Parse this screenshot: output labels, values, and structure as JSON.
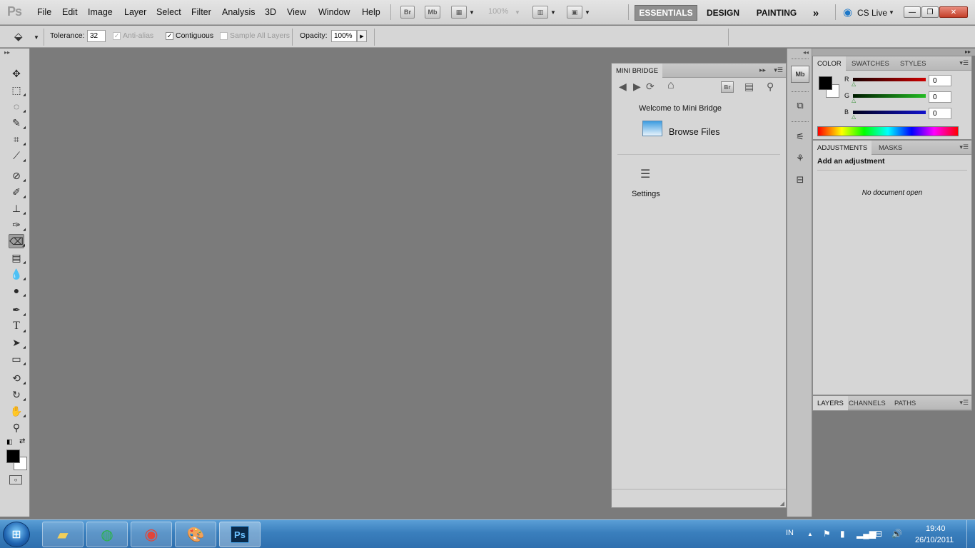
{
  "menubar": {
    "logo": "Ps",
    "items": [
      "File",
      "Edit",
      "Image",
      "Layer",
      "Select",
      "Filter",
      "Analysis",
      "3D",
      "View",
      "Window",
      "Help"
    ],
    "bridge_btn": "Br",
    "minibridge_btn": "Mb",
    "zoom": "100%",
    "workspaces": [
      "ESSENTIALS",
      "DESIGN",
      "PAINTING"
    ],
    "more_workspaces": "»",
    "cslive": "CS Live"
  },
  "options": {
    "tolerance_label": "Tolerance:",
    "tolerance_value": "32",
    "antialias_label": "Anti-alias",
    "contiguous_label": "Contiguous",
    "sample_all_label": "Sample All Layers",
    "opacity_label": "Opacity:",
    "opacity_value": "100%"
  },
  "minibridge": {
    "tab": "MINI BRIDGE",
    "welcome": "Welcome to Mini Bridge",
    "browse": "Browse Files",
    "settings": "Settings",
    "br_btn": "Br"
  },
  "dock": {
    "mb_label": "Mb"
  },
  "color_panel": {
    "tabs": [
      "COLOR",
      "SWATCHES",
      "STYLES"
    ],
    "r_label": "R",
    "g_label": "G",
    "b_label": "B",
    "r_value": "0",
    "g_value": "0",
    "b_value": "0",
    "colors": {
      "r": "#cc0000",
      "g": "#22bb22",
      "b": "#1111cc"
    }
  },
  "adjustments_panel": {
    "tabs": [
      "ADJUSTMENTS",
      "MASKS"
    ],
    "title": "Add an adjustment",
    "status": "No document open"
  },
  "layers_panel": {
    "tabs": [
      "LAYERS",
      "CHANNELS",
      "PATHS"
    ]
  },
  "taskbar": {
    "lang": "IN",
    "time": "19:40",
    "date": "26/10/2011",
    "ps_label": "Ps"
  }
}
